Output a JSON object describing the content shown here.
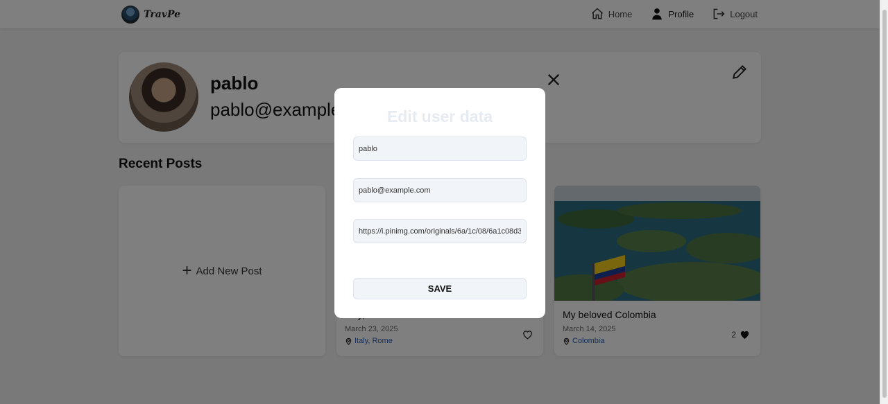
{
  "header": {
    "logo_text": "TravPe",
    "nav": [
      {
        "label": "Home",
        "icon": "home-icon"
      },
      {
        "label": "Profile",
        "icon": "user-icon"
      },
      {
        "label": "Logout",
        "icon": "logout-icon"
      }
    ]
  },
  "profile": {
    "name": "pablo",
    "email": "pablo@example.com"
  },
  "recent_posts": {
    "title": "Recent Posts",
    "add_label": "Add New Post",
    "posts": [
      {
        "title": "Italy, Beautiful Rome",
        "date": "March 23, 2025",
        "location": "Italy, Rome",
        "likes": "",
        "liked": false
      },
      {
        "title": "My beloved Colombia",
        "date": "March 14, 2025",
        "location": "Colombia",
        "likes": "2",
        "liked": true
      }
    ]
  },
  "modal": {
    "title": "Edit user data",
    "username_value": "pablo",
    "email_value": "pablo@example.com",
    "avatar_url_value": "https://i.pinimg.com/originals/6a/1c/08/6a1c08d3",
    "save_label": "SAVE"
  },
  "colors": {
    "overlay": "#00000080",
    "link": "#2a5db0",
    "modal_title": "#e6ebf2"
  }
}
